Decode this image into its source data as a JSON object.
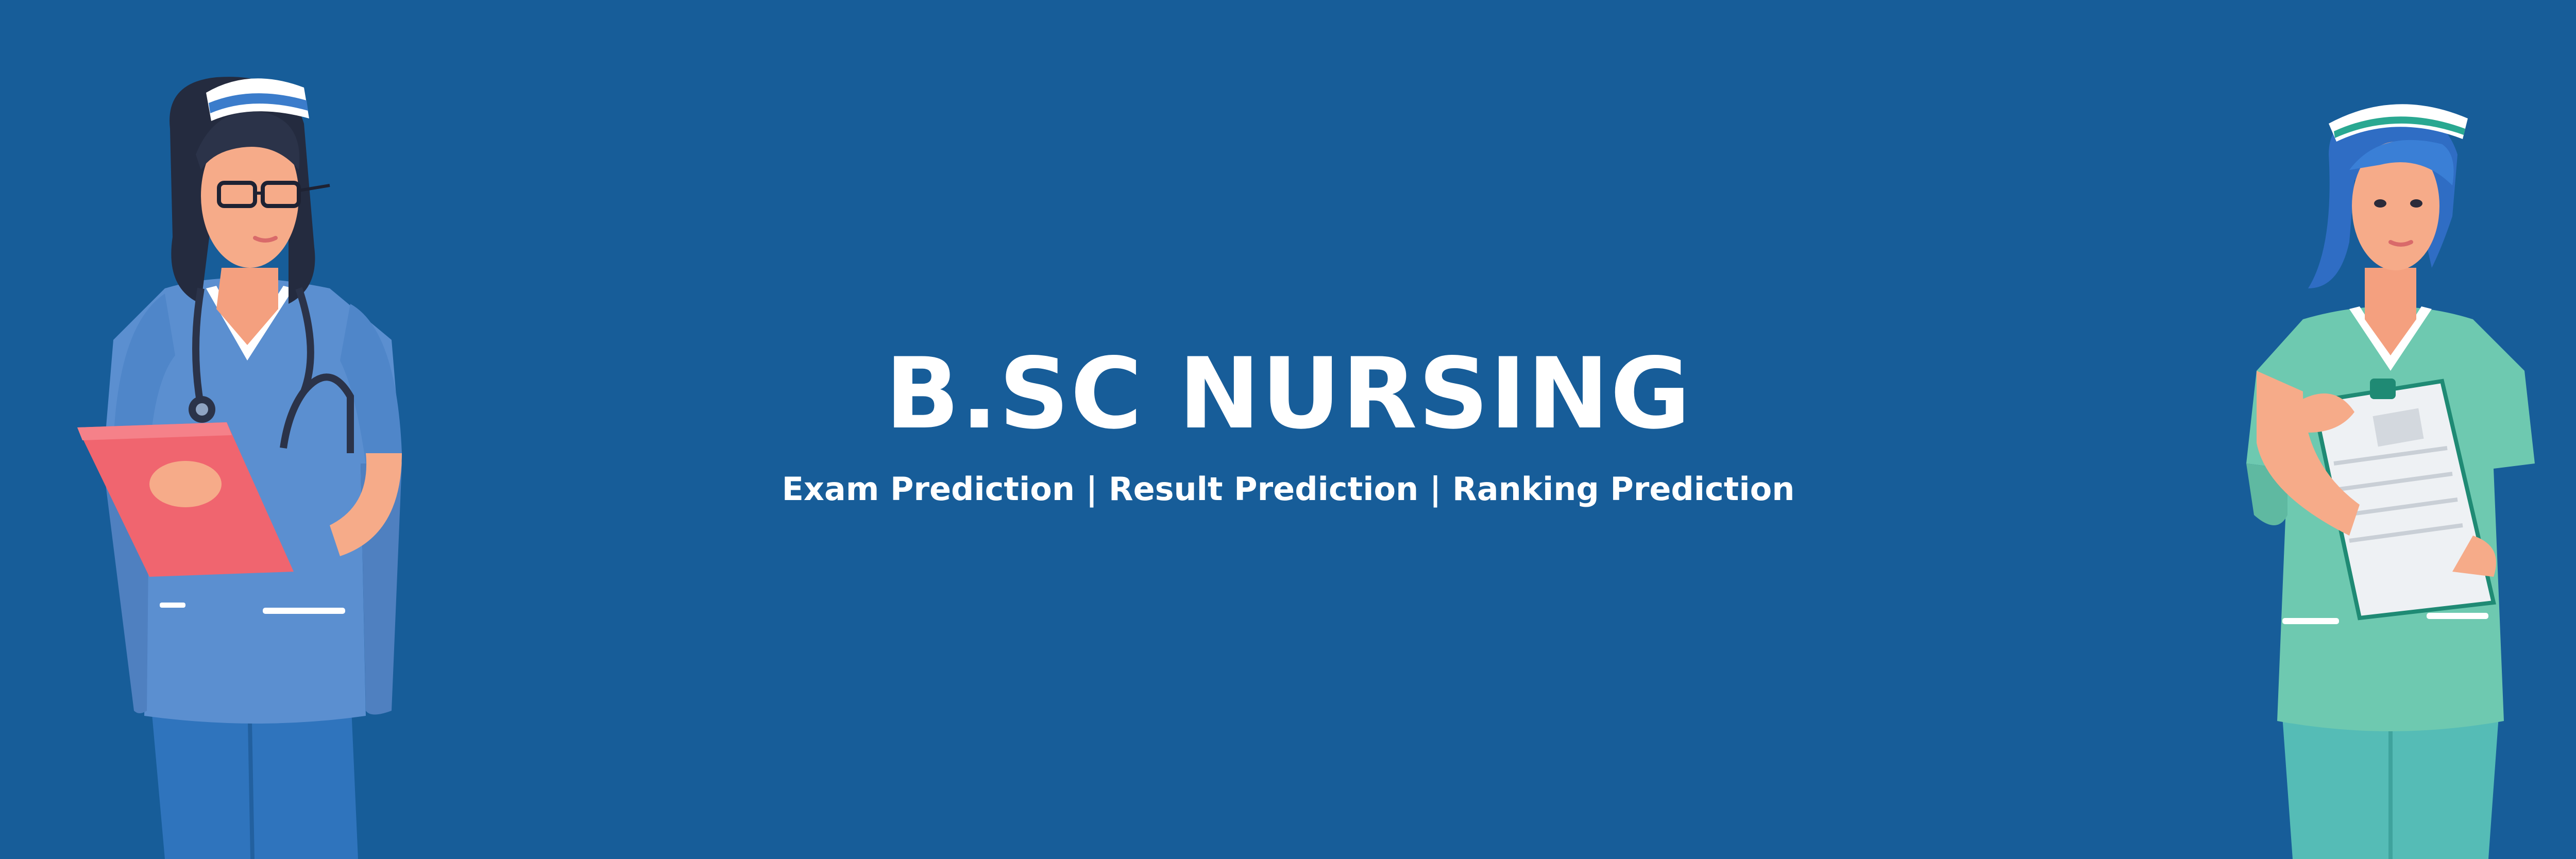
{
  "banner": {
    "title": "B.SC NURSING",
    "subtitle": "Exam Prediction | Result Prediction | Ranking Prediction"
  },
  "colors": {
    "background": "#175d99",
    "text": "#ffffff",
    "left_scrubs": "#5b8fd0",
    "right_scrubs": "#6ec9b0",
    "clipboard_left": "#f0656f"
  },
  "illustrations": {
    "left": "nurse-with-stethoscope-and-red-clipboard-illustration",
    "right": "nurse-with-green-scrubs-holding-clipboard-illustration"
  }
}
